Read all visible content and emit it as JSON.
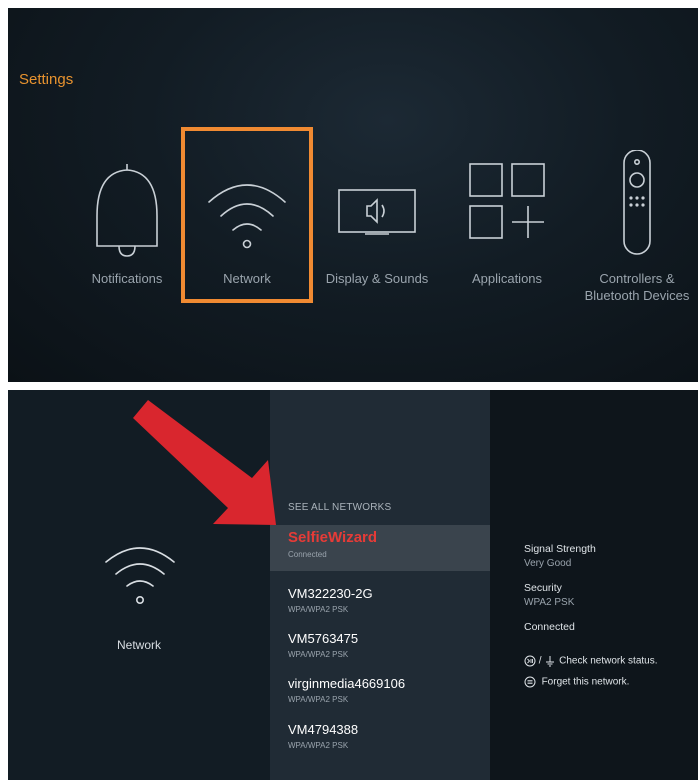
{
  "settings": {
    "title": "Settings",
    "categories": [
      {
        "label": "Notifications",
        "icon": "bell-icon"
      },
      {
        "label": "Network",
        "icon": "wifi-icon"
      },
      {
        "label": "Display & Sounds",
        "icon": "tv-speaker-icon"
      },
      {
        "label": "Applications",
        "icon": "apps-grid-icon"
      },
      {
        "label": "Controllers &\nBluetooth Devices",
        "icon": "remote-icon"
      }
    ],
    "focused": "Network",
    "focus_color": "#f08a32"
  },
  "network_screen": {
    "left_label": "Network",
    "see_all": "SEE ALL NETWORKS",
    "networks": [
      {
        "name": "SelfieWizard",
        "status": "Connected",
        "selected": true
      },
      {
        "name": "VM322230-2G",
        "status": "WPA/WPA2 PSK"
      },
      {
        "name": "VM5763475",
        "status": "WPA/WPA2 PSK"
      },
      {
        "name": "virginmedia4669106",
        "status": "WPA/WPA2 PSK"
      },
      {
        "name": "VM4794388",
        "status": "WPA/WPA2 PSK"
      }
    ],
    "details": {
      "signal_label": "Signal Strength",
      "signal_value": "Very Good",
      "security_label": "Security",
      "security_value": "WPA2 PSK",
      "connection": "Connected",
      "hint_check": "Check network status.",
      "hint_forget": "Forget this network.",
      "hint_check_separator": "/"
    },
    "arrow_color": "#d9262e",
    "selected_color": "#e63b37"
  }
}
